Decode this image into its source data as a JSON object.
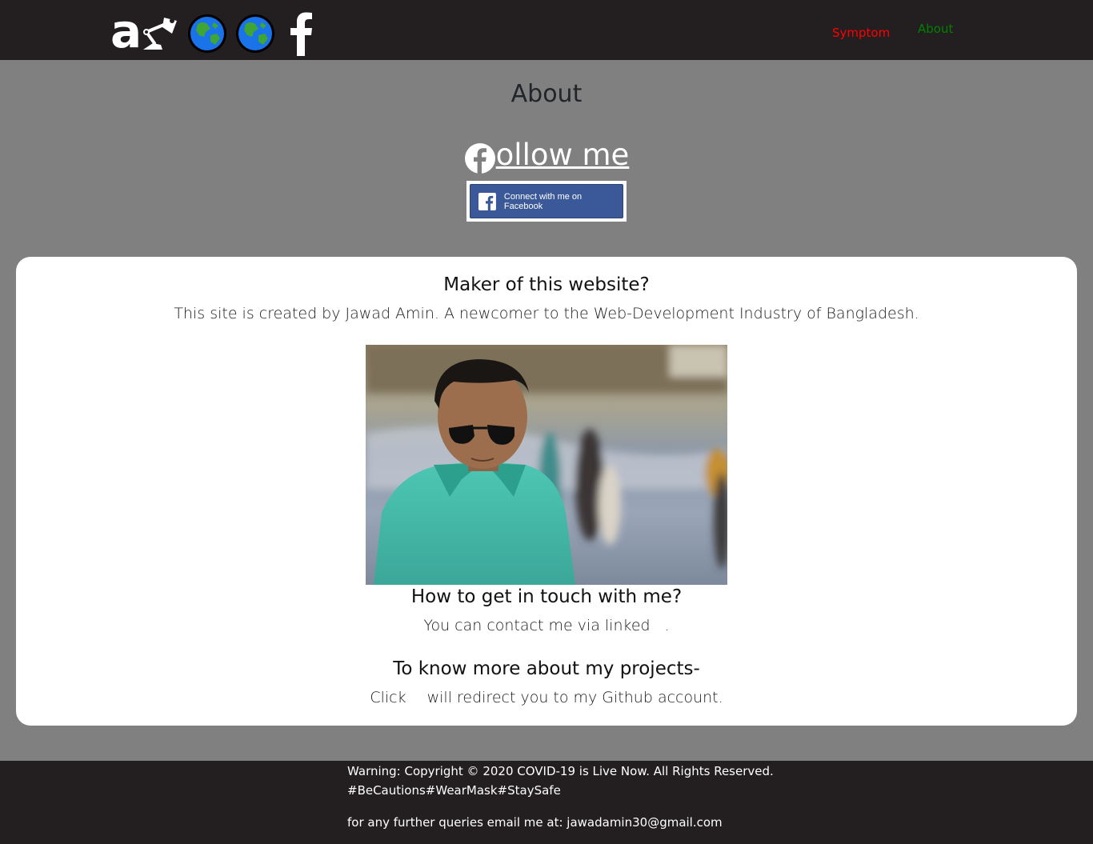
{
  "nav": {
    "brand_letter": "a",
    "links": [
      {
        "label": "Symptom",
        "color": "#ff0000"
      },
      {
        "label": "About",
        "color": "#008000"
      }
    ]
  },
  "header": {
    "title": "About",
    "follow_text": "ollow me",
    "fb_button_label": "Connect with me on Facebook"
  },
  "card": {
    "maker_heading": "Maker of this website?",
    "maker_text": "This site is created by Jawad Amin. A newcomer to the Web-Development Industry of Bangladesh.",
    "touch_heading": "How to get in touch with me?",
    "touch_text_before": "You can contact me via linked",
    "touch_text_after": ".",
    "projects_heading": "To know more about my projects-",
    "projects_text_before": "Click",
    "projects_text_after": "will redirect you to my Github account."
  },
  "footer": {
    "copyright": "Warning: Copyright © 2020 COVID-19 is Live Now. All Rights Reserved.",
    "hashtags": "#BeCautions#WearMask#StaySafe",
    "email_line": "for any further queries email me at: jawadamin30@gmail.com"
  },
  "colors": {
    "navbar_bg": "#231f20",
    "page_bg": "#808080",
    "facebook_blue": "#3b5998"
  },
  "icons": [
    "lamp-icon",
    "globe-icon",
    "globe-icon",
    "facebook-f-icon",
    "facebook-circle-icon",
    "facebook-square-icon"
  ]
}
